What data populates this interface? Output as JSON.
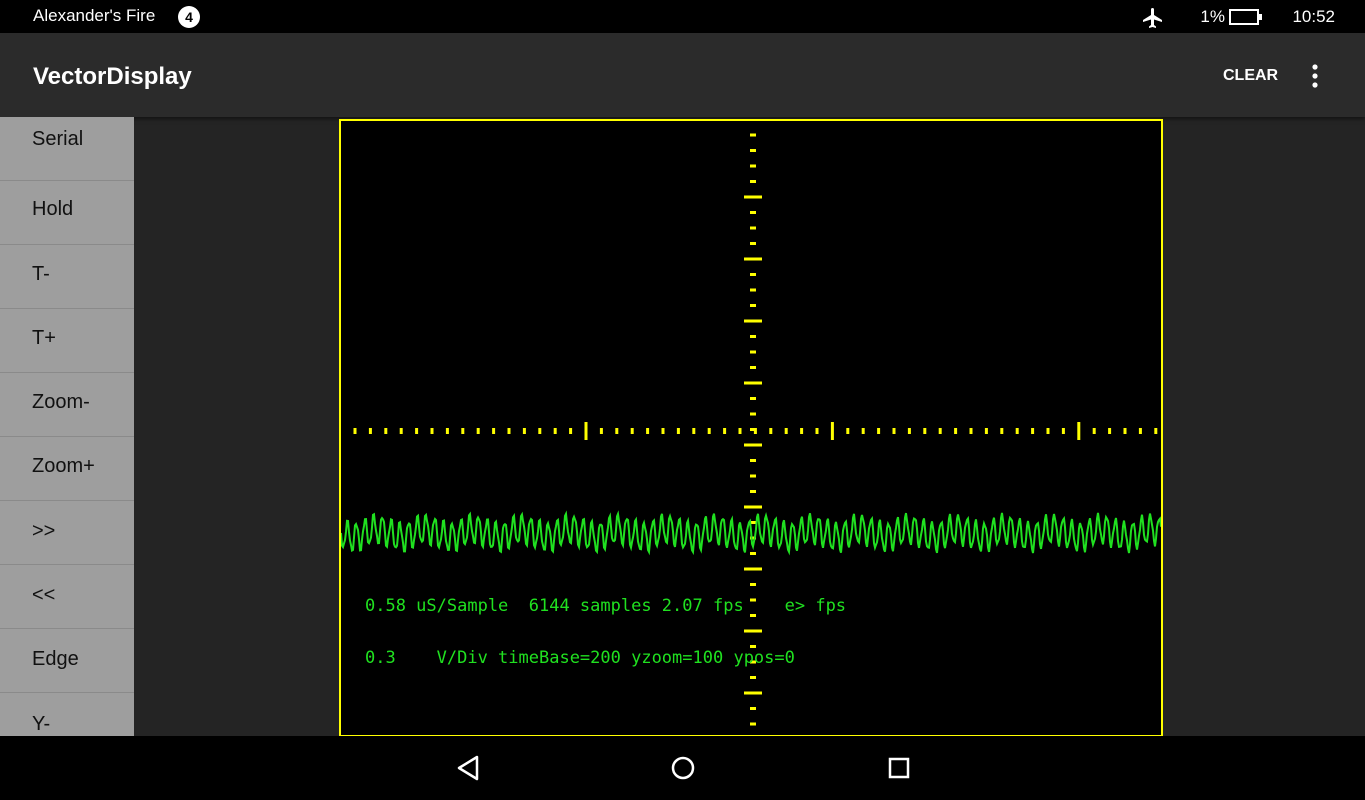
{
  "status": {
    "device_name": "Alexander's Fire",
    "notification_count": "4",
    "battery": "1%",
    "time": "10:52"
  },
  "app": {
    "title": "VectorDisplay",
    "clear_label": "CLEAR"
  },
  "sidebar": {
    "items": [
      {
        "label": "Serial"
      },
      {
        "label": "Hold"
      },
      {
        "label": "T-"
      },
      {
        "label": "T+"
      },
      {
        "label": "Zoom-"
      },
      {
        "label": "Zoom+"
      },
      {
        "label": ">>"
      },
      {
        "label": "<<"
      },
      {
        "label": "Edge"
      },
      {
        "label": "Y-"
      }
    ]
  },
  "scope": {
    "line1": "0.58 uS/Sample  6144 samples 2.07 fps    e> fps",
    "line2": "0.3    V/Div timeBase=200 yzoom=100 ypos=0",
    "colors": {
      "frame": "#ffff00",
      "trace": "#20e020",
      "background": "#000000"
    }
  },
  "icons": [
    "airplane-icon",
    "battery-icon",
    "overflow-menu-icon",
    "back-icon",
    "home-icon",
    "recents-icon"
  ]
}
